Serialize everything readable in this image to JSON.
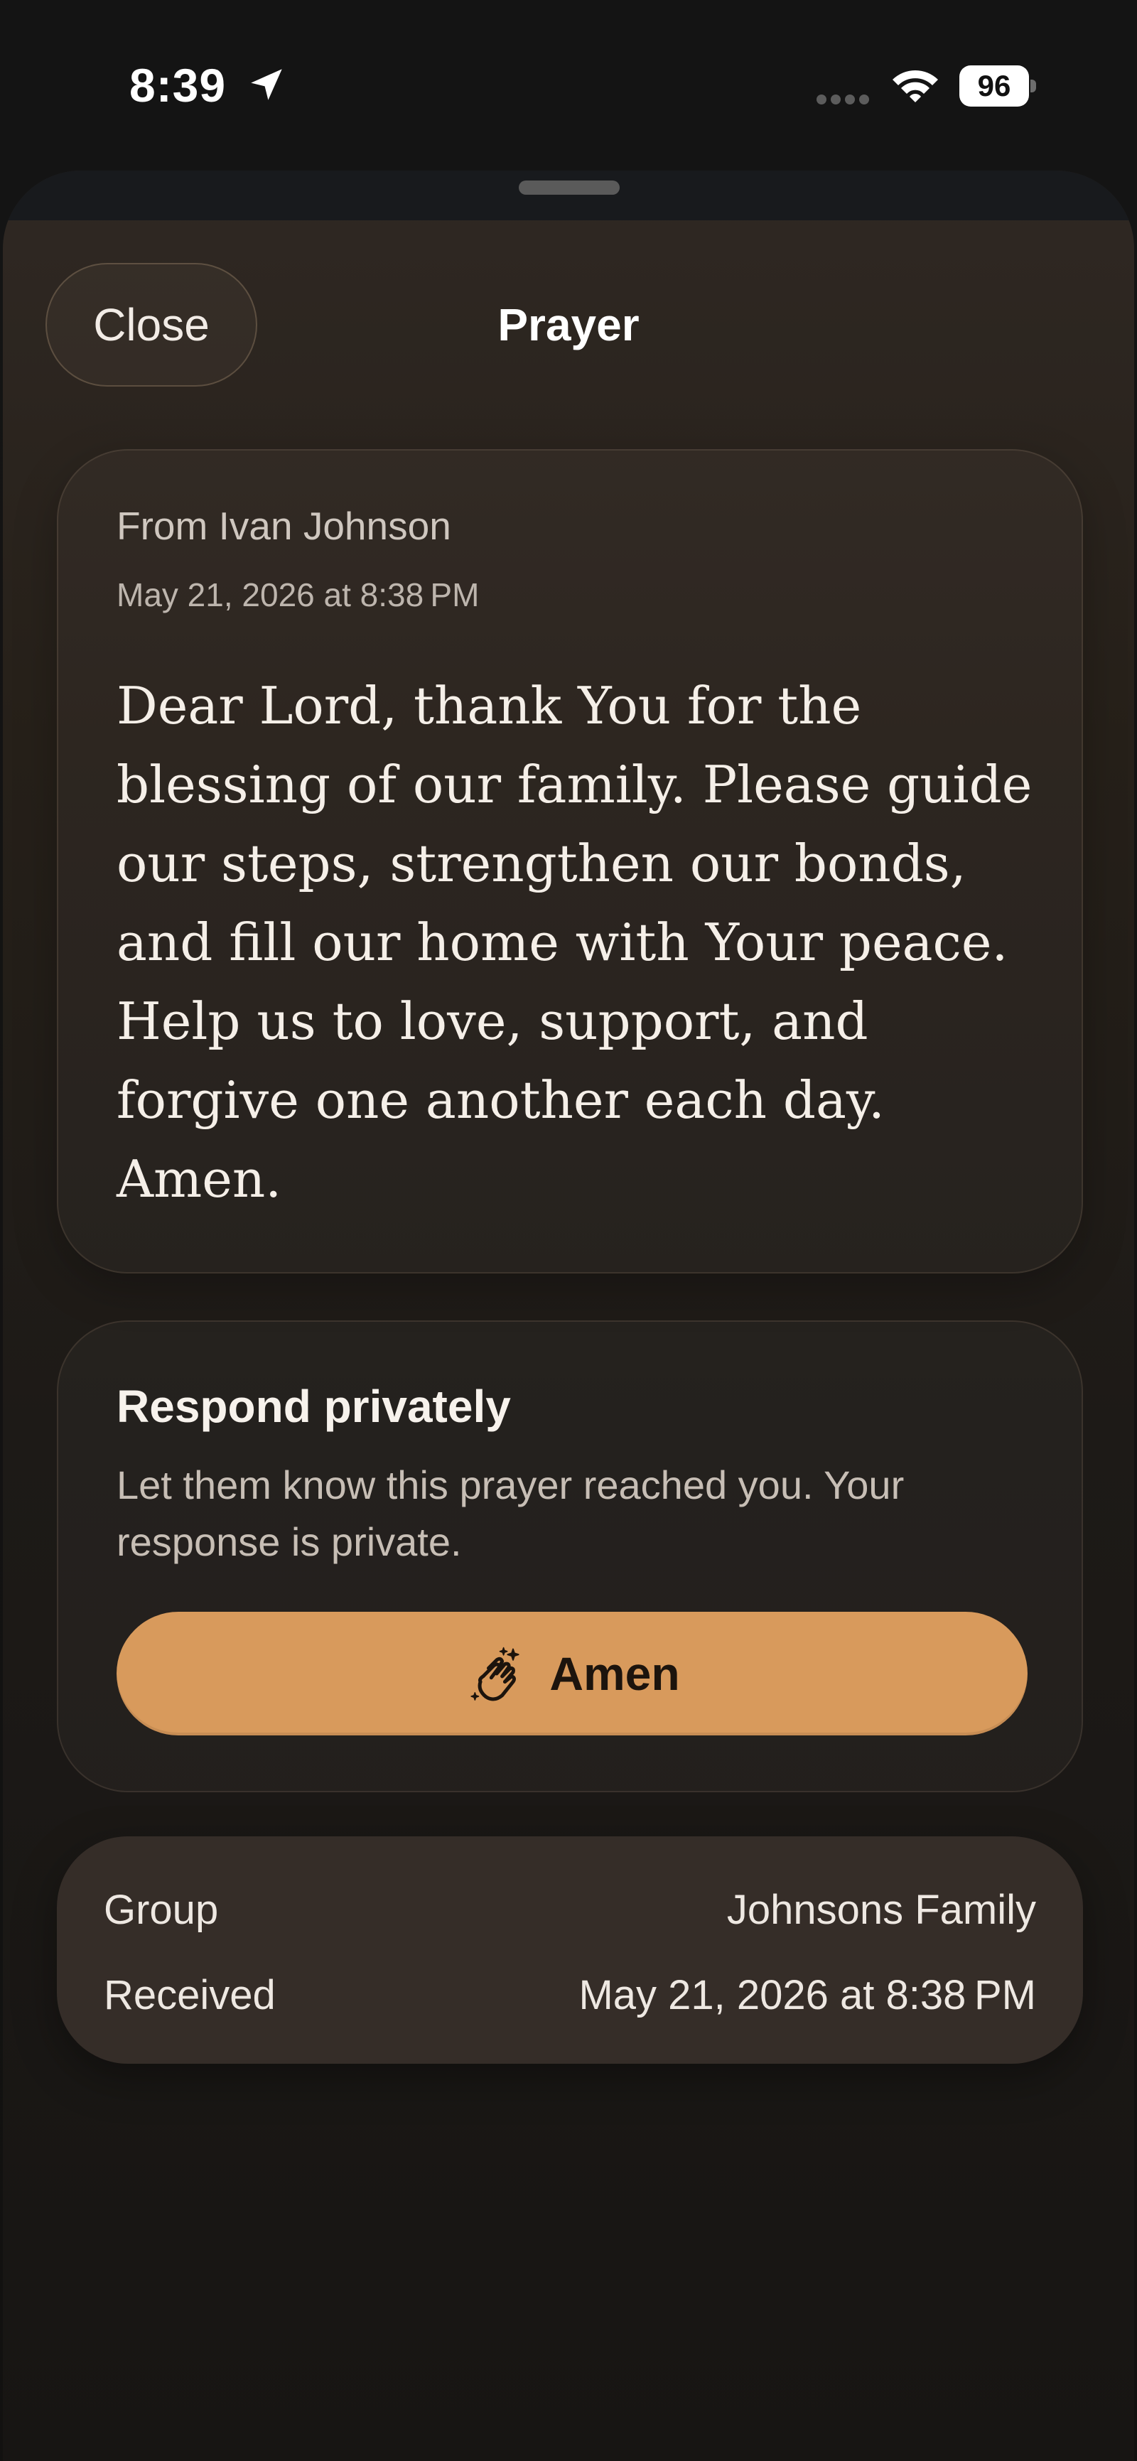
{
  "status_bar": {
    "time": "8:39",
    "battery_level": "96",
    "icons": [
      "location-arrow-icon",
      "cellular-dots-icon",
      "wifi-icon",
      "battery-icon"
    ]
  },
  "header": {
    "close_label": "Close",
    "title": "Prayer"
  },
  "prayer": {
    "from": "From Ivan Johnson",
    "date": "May 21, 2026 at 8:38 PM",
    "text": "Dear Lord, thank You for the blessing of our family. Please guide our steps, strengthen our bonds, and fill our home with Your peace. Help us to love, support, and forgive one another each day. Amen."
  },
  "respond": {
    "title": "Respond privately",
    "description": "Let them know this prayer reached you. Your response is private.",
    "button_label": "Amen",
    "button_icon": "praying-hands-icon"
  },
  "details": {
    "rows": [
      {
        "label": "Group",
        "value": "Johnsons Family"
      },
      {
        "label": "Received",
        "value": "May 21, 2026 at 8:38 PM"
      }
    ]
  },
  "colors": {
    "background": "#121110",
    "card": "#352d28",
    "accent": "#d89a5c",
    "accent_text": "#1c140d",
    "secondary_text": "#c7beb5"
  }
}
